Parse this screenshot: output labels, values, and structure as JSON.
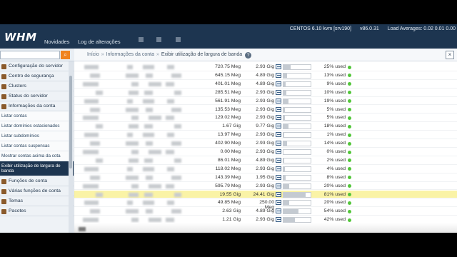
{
  "topbar": {
    "logo": "WHM",
    "nav": [
      "Novidades",
      "Log de alterações"
    ],
    "os": "CENTOS 6.10 kvm [srv190]",
    "version": "v86.0.31",
    "load": "Load Averages: 0.02 0.01 0.00"
  },
  "search": {
    "placeholder": "",
    "button_icon": "search-icon"
  },
  "sidebar": {
    "items": [
      {
        "label": "Configuração do servidor",
        "type": "category",
        "icon": "settings-icon"
      },
      {
        "label": "Centro de segurança",
        "type": "category",
        "icon": "lock-icon"
      },
      {
        "label": "Clusters",
        "type": "category",
        "icon": "cluster-icon"
      },
      {
        "label": "Status do servidor",
        "type": "category",
        "icon": "server-icon"
      },
      {
        "label": "Informações da conta",
        "type": "category",
        "icon": "info-icon"
      },
      {
        "label": "Listar contas",
        "type": "sub"
      },
      {
        "label": "Listar domínios estacionados",
        "type": "sub"
      },
      {
        "label": "Listar subdomínios",
        "type": "sub"
      },
      {
        "label": "Listar contas suspensas",
        "type": "sub"
      },
      {
        "label": "Mostrar contas acima da cota",
        "type": "sub"
      },
      {
        "label": "Exibir utilização de largura de banda",
        "type": "sub",
        "active": true
      },
      {
        "label": "Funções de conta",
        "type": "category",
        "icon": "account-icon"
      },
      {
        "label": "Várias funções de conta",
        "type": "category",
        "icon": "accounts-icon"
      },
      {
        "label": "Temas",
        "type": "category",
        "icon": "theme-icon"
      },
      {
        "label": "Pacotes",
        "type": "category",
        "icon": "package-icon"
      }
    ]
  },
  "breadcrumb": {
    "items": [
      "Início",
      "Informações da conta",
      "Exibir utilização de largura de banda"
    ],
    "separator": "»",
    "help_icon": "?"
  },
  "close_icon": "×",
  "table": {
    "rows": [
      {
        "used": "720.75 Meg",
        "limit": "2.93 Gig",
        "percent": "25% used",
        "fill": 0.25
      },
      {
        "used": "645.15 Meg",
        "limit": "4.89 Gig",
        "percent": "13% used",
        "fill": 0.13
      },
      {
        "used": "401.01 Meg",
        "limit": "4.89 Gig",
        "percent": "9% used",
        "fill": 0.09
      },
      {
        "used": "285.51 Meg",
        "limit": "2.93 Gig",
        "percent": "10% used",
        "fill": 0.1
      },
      {
        "used": "561.91 Meg",
        "limit": "2.93 Gig",
        "percent": "19% used",
        "fill": 0.19
      },
      {
        "used": "135.53 Meg",
        "limit": "2.93 Gig",
        "percent": "5% used",
        "fill": 0.05
      },
      {
        "used": "129.02 Meg",
        "limit": "2.93 Gig",
        "percent": "5% used",
        "fill": 0.05
      },
      {
        "used": "1.67 Gig",
        "limit": "9.77 Gig",
        "percent": "18% used",
        "fill": 0.18
      },
      {
        "used": "13.97 Meg",
        "limit": "2.93 Gig",
        "percent": "1% used",
        "fill": 0.01
      },
      {
        "used": "402.90 Meg",
        "limit": "2.93 Gig",
        "percent": "14% used",
        "fill": 0.14
      },
      {
        "used": "0.00 Meg",
        "limit": "2.93 Gig",
        "percent": "0% used",
        "fill": 0.0
      },
      {
        "used": "86.01 Meg",
        "limit": "4.89 Gig",
        "percent": "2% used",
        "fill": 0.02
      },
      {
        "used": "118.02 Meg",
        "limit": "2.93 Gig",
        "percent": "4% used",
        "fill": 0.04
      },
      {
        "used": "143.39 Meg",
        "limit": "1.95 Gig",
        "percent": "8% used",
        "fill": 0.08
      },
      {
        "used": "595.79 Meg",
        "limit": "2.93 Gig",
        "percent": "20% used",
        "fill": 0.2
      },
      {
        "used": "19.55 Gig",
        "limit": "24.41 Gig",
        "percent": "81% used",
        "fill": 0.81,
        "highlight": true
      },
      {
        "used": "49.85 Meg",
        "limit": "250.00 Meg",
        "percent": "20% used",
        "fill": 0.2
      },
      {
        "used": "2.63 Gig",
        "limit": "4.89 Gig",
        "percent": "54% used",
        "fill": 0.54
      },
      {
        "used": "1.21 Gig",
        "limit": "2.93 Gig",
        "percent": "42% used",
        "fill": 0.42
      }
    ]
  },
  "colors": {
    "topbar": "#1d3550",
    "highlight_row": "#faf3a6",
    "status_ok": "#52c63a",
    "search_button": "#f0831f"
  }
}
